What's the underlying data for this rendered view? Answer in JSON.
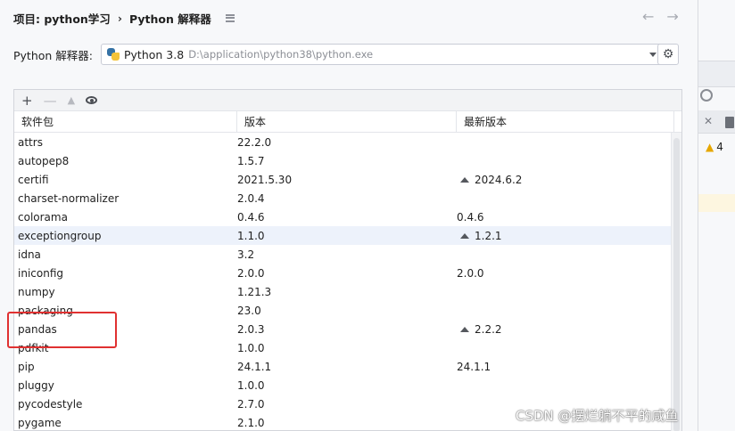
{
  "dialog": {
    "breadcrumb_project": "项目: python学习",
    "breadcrumb_sep": "›",
    "breadcrumb_page": "Python 解释器",
    "nav_back": "←",
    "nav_forward": "→"
  },
  "interpreter": {
    "label": "Python 解释器:",
    "name": "Python 3.8",
    "path": "D:\\application\\python38\\python.exe",
    "gear_glyph": "⚙"
  },
  "toolbar": {
    "add": "+",
    "remove": "—",
    "upgrade": "▲"
  },
  "table": {
    "headers": [
      "软件包",
      "版本",
      "最新版本"
    ],
    "rows": [
      {
        "name": "attrs",
        "version": "22.2.0",
        "latest": "",
        "upgrade": false
      },
      {
        "name": "autopep8",
        "version": "1.5.7",
        "latest": "",
        "upgrade": false
      },
      {
        "name": "certifi",
        "version": "2021.5.30",
        "latest": "2024.6.2",
        "upgrade": true
      },
      {
        "name": "charset-normalizer",
        "version": "2.0.4",
        "latest": "",
        "upgrade": false
      },
      {
        "name": "colorama",
        "version": "0.4.6",
        "latest": "0.4.6",
        "upgrade": false
      },
      {
        "name": "exceptiongroup",
        "version": "1.1.0",
        "latest": "1.2.1",
        "upgrade": true,
        "selected": true
      },
      {
        "name": "idna",
        "version": "3.2",
        "latest": "",
        "upgrade": false
      },
      {
        "name": "iniconfig",
        "version": "2.0.0",
        "latest": "2.0.0",
        "upgrade": false
      },
      {
        "name": "numpy",
        "version": "1.21.3",
        "latest": "",
        "upgrade": false
      },
      {
        "name": "packaging",
        "version": "23.0",
        "latest": "",
        "upgrade": false
      },
      {
        "name": "pandas",
        "version": "2.0.3",
        "latest": "2.2.2",
        "upgrade": true
      },
      {
        "name": "pdfkit",
        "version": "1.0.0",
        "latest": "",
        "upgrade": false
      },
      {
        "name": "pip",
        "version": "24.1.1",
        "latest": "24.1.1",
        "upgrade": false
      },
      {
        "name": "pluggy",
        "version": "1.0.0",
        "latest": "",
        "upgrade": false
      },
      {
        "name": "pycodestyle",
        "version": "2.7.0",
        "latest": "",
        "upgrade": false
      },
      {
        "name": "pygame",
        "version": "2.1.0",
        "latest": "",
        "upgrade": false
      }
    ]
  },
  "side_ide": {
    "close_glyph": "✕",
    "warning_count": "4"
  },
  "watermark": "CSDN @摆烂躺不平的咸鱼",
  "colors": {
    "accent_annotation": "#e03131",
    "selected_row": "#edf2fb",
    "warning": "#e6a700"
  }
}
